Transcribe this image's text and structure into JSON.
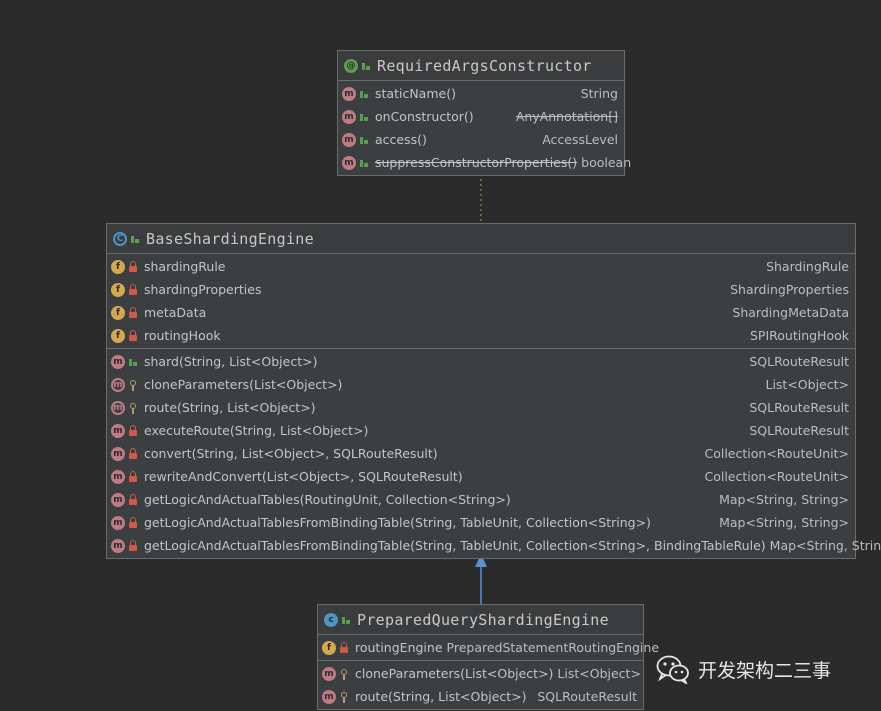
{
  "required_args_constructor": {
    "title": "RequiredArgsConstructor",
    "icon": "annotation-icon",
    "methods": [
      {
        "name": "staticName()",
        "type": "String",
        "strike_type": false,
        "strike_name": false
      },
      {
        "name": "onConstructor()",
        "type": "AnyAnnotation[]",
        "strike_type": true,
        "strike_name": false
      },
      {
        "name": "access()",
        "type": "AccessLevel",
        "strike_type": false,
        "strike_name": false
      },
      {
        "name": "suppressConstructorProperties()",
        "type": "boolean",
        "strike_type": false,
        "strike_name": true
      }
    ]
  },
  "base_sharding_engine": {
    "title": "BaseShardingEngine",
    "icon": "abstract-class-icon",
    "fields": [
      {
        "name": "shardingRule",
        "type": "ShardingRule"
      },
      {
        "name": "shardingProperties",
        "type": "ShardingProperties"
      },
      {
        "name": "metaData",
        "type": "ShardingMetaData"
      },
      {
        "name": "routingHook",
        "type": "SPIRoutingHook"
      }
    ],
    "methods": [
      {
        "name": "shard(String, List<Object>)",
        "type": "SQLRouteResult",
        "vis": "pub",
        "abstract": false
      },
      {
        "name": "cloneParameters(List<Object>)",
        "type": "List<Object>",
        "vis": "prot",
        "abstract": true
      },
      {
        "name": "route(String, List<Object>)",
        "type": "SQLRouteResult",
        "vis": "prot",
        "abstract": true
      },
      {
        "name": "executeRoute(String, List<Object>)",
        "type": "SQLRouteResult",
        "vis": "priv",
        "abstract": false
      },
      {
        "name": "convert(String, List<Object>, SQLRouteResult)",
        "type": "Collection<RouteUnit>",
        "vis": "priv",
        "abstract": false
      },
      {
        "name": "rewriteAndConvert(List<Object>, SQLRouteResult)",
        "type": "Collection<RouteUnit>",
        "vis": "priv",
        "abstract": false
      },
      {
        "name": "getLogicAndActualTables(RoutingUnit, Collection<String>)",
        "type": "Map<String, String>",
        "vis": "priv",
        "abstract": false
      },
      {
        "name": "getLogicAndActualTablesFromBindingTable(String, TableUnit, Collection<String>)",
        "type": "Map<String, String>",
        "vis": "priv",
        "abstract": false
      },
      {
        "name": "getLogicAndActualTablesFromBindingTable(String, TableUnit, Collection<String>, BindingTableRule)",
        "type": "Map<String, String>",
        "vis": "priv",
        "abstract": false
      }
    ]
  },
  "prepared_query_sharding_engine": {
    "title": "PreparedQueryShardingEngine",
    "icon": "class-icon",
    "fields": [
      {
        "name": "routingEngine",
        "type": "PreparedStatementRoutingEngine"
      }
    ],
    "methods": [
      {
        "name": "cloneParameters(List<Object>)",
        "type": "List<Object>"
      },
      {
        "name": "route(String, List<Object>)",
        "type": "SQLRouteResult"
      }
    ]
  },
  "watermark": {
    "text": "开发架构二三事",
    "icon": "wechat-icon"
  },
  "colors": {
    "background": "#2b2b2b",
    "box": "#3c3f41",
    "border": "#6b6b6b",
    "inheritance_arrow": "#5b8fd6",
    "annotation_link": "#a0a060"
  }
}
